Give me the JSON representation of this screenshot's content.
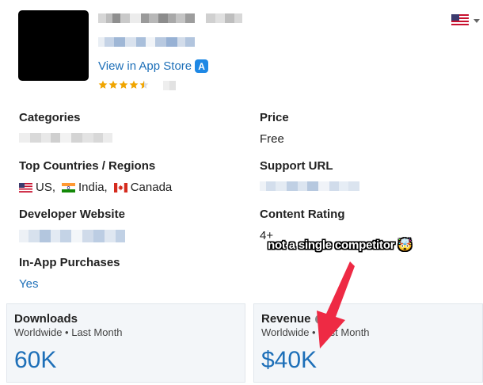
{
  "app": {
    "store_link_label": "View in App Store",
    "rating_stars": 4.5
  },
  "header": {
    "region_flag": "us-flag-icon"
  },
  "fields": {
    "categories_label": "Categories",
    "price_label": "Price",
    "price_value": "Free",
    "top_countries_label": "Top Countries / Regions",
    "countries": [
      {
        "name": "US,",
        "flag": "us-flag-icon"
      },
      {
        "name": "India,",
        "flag": "india-flag-icon"
      },
      {
        "name": "Canada",
        "flag": "canada-flag-icon"
      }
    ],
    "support_url_label": "Support URL",
    "developer_website_label": "Developer Website",
    "content_rating_label": "Content Rating",
    "content_rating_value": "4+",
    "iap_label": "In-App Purchases",
    "iap_value": "Yes"
  },
  "cards": {
    "downloads": {
      "title": "Downloads",
      "subtitle": "Worldwide • Last Month",
      "value": "60K"
    },
    "revenue": {
      "title": "Revenue",
      "subtitle": "Worldwide • Last Month",
      "value": "$40K"
    }
  },
  "annotation": {
    "text": "not a single competitor 🤯"
  },
  "colors": {
    "link": "#1d6fb8",
    "star": "#f0a500",
    "arrow": "#ee2a44",
    "card_bg": "#f3f6f9"
  }
}
